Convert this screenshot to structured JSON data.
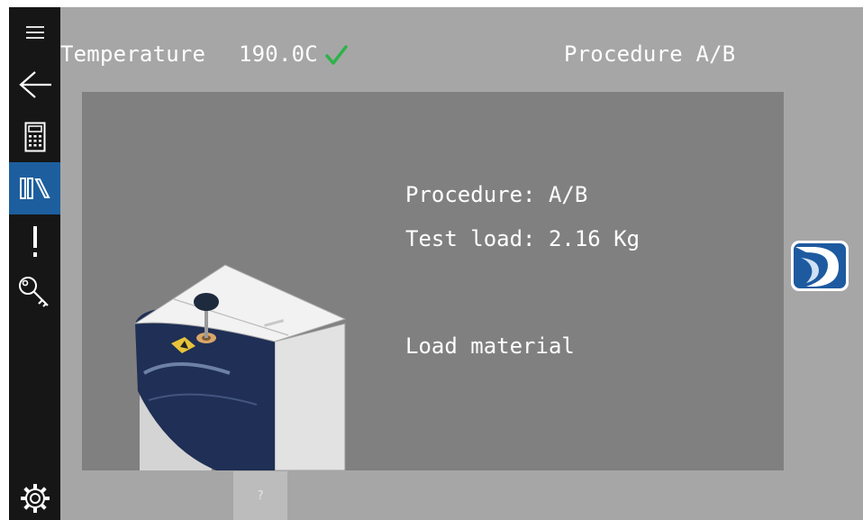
{
  "sidebar": {
    "items": [
      {
        "icon": "hamburger-menu-icon",
        "active": false
      },
      {
        "icon": "back-arrow-icon",
        "active": false
      },
      {
        "icon": "calculator-icon",
        "active": false
      },
      {
        "icon": "library-icon",
        "active": true
      },
      {
        "icon": "exclamation-icon",
        "active": false
      },
      {
        "icon": "key-icon",
        "active": false
      },
      {
        "icon": "gear-icon",
        "active": false
      }
    ],
    "active_color": "#1d5f9e",
    "background": "#161616"
  },
  "header": {
    "temperature_label": "Temperature",
    "temperature_value": "190.0C",
    "temperature_ok_icon": "check-icon",
    "check_color": "#2db34a",
    "procedure": "Procedure A/B"
  },
  "panel": {
    "procedure_line": "Procedure: A/B",
    "test_load_line": "Test load: 2.16 Kg",
    "status_line": "Load material",
    "device_image": "instrument-illustration"
  },
  "next_button": {
    "icon": "next-logo-icon"
  },
  "help_button": {
    "label": "?"
  }
}
